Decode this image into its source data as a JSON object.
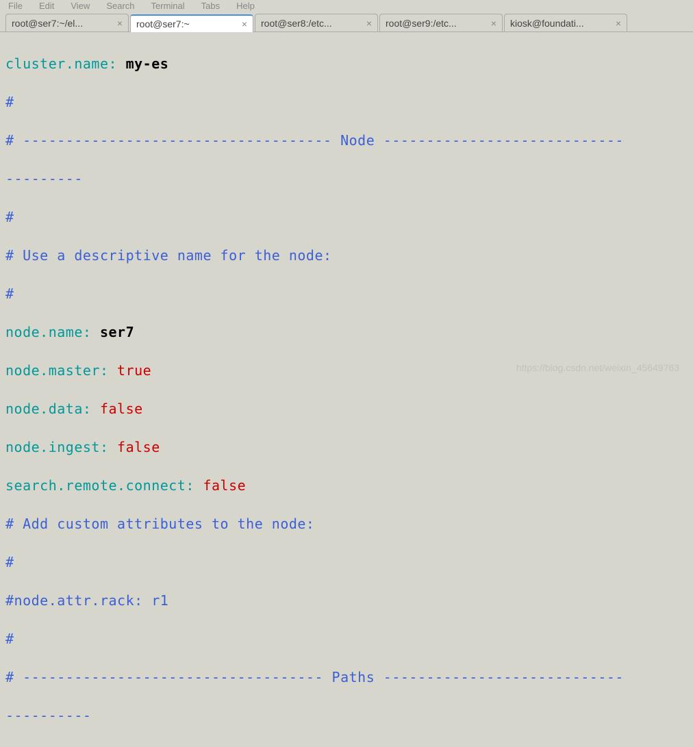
{
  "menu": [
    "File",
    "Edit",
    "View",
    "Search",
    "Terminal",
    "Tabs",
    "Help"
  ],
  "tabs": [
    {
      "label": "root@ser7:~/el...",
      "active": false
    },
    {
      "label": "root@ser7:~",
      "active": true
    },
    {
      "label": "root@ser8:/etc...",
      "active": false
    },
    {
      "label": "root@ser9:/etc...",
      "active": false
    },
    {
      "label": "kiosk@foundati...",
      "active": false
    }
  ],
  "close_glyph": "×",
  "content": {
    "l0_key": "cluster.name",
    "l0_colon": ": ",
    "l0_val": "my-es",
    "l1": "#",
    "l2": "# ------------------------------------ Node ----------------------------",
    "l3": "---------",
    "l4": "#",
    "l5": "# Use a descriptive name for the node:",
    "l6": "#",
    "l7_key": "node.name",
    "l7_colon": ": ",
    "l7_val": "ser7",
    "l8_key": "node.master",
    "l8_colon": ": ",
    "l8_val": "true",
    "l9_key": "node.data",
    "l9_colon": ": ",
    "l9_val": "false",
    "l10_key": "node.ingest",
    "l10_colon": ": ",
    "l10_val": "false",
    "l11_key": "search.remote.connect",
    "l11_colon": ": ",
    "l11_val": "false",
    "l12": "# Add custom attributes to the node:",
    "l13": "#",
    "l14": "#node.attr.rack: r1",
    "l15": "#",
    "l16": "# ----------------------------------- Paths ----------------------------",
    "l17": "----------"
  },
  "watermark": "https://blog.csdn.net/weixin_45649763"
}
